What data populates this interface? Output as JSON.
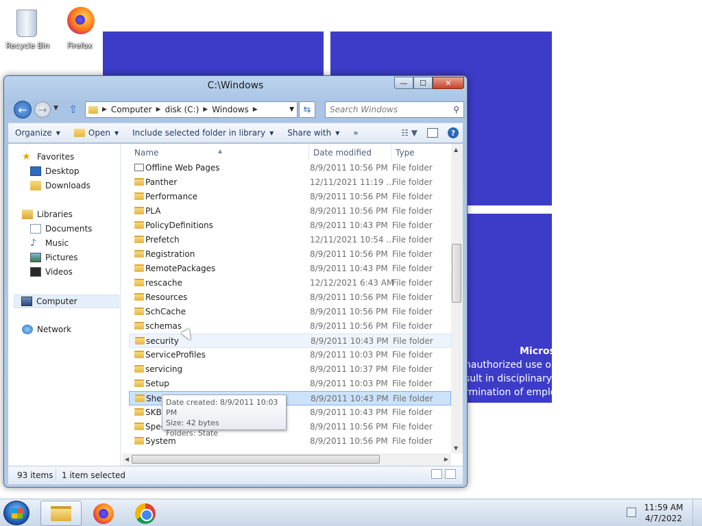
{
  "desktop": {
    "icons": [
      {
        "label": "Recycle Bin",
        "icon": "recycle-bin-icon"
      },
      {
        "label": "Firefox",
        "icon": "firefox-icon"
      }
    ],
    "notice": {
      "title": "Micros",
      "lines": [
        "nauthorized use or",
        "sult in disciplinary",
        "rmination of emplo"
      ]
    },
    "colors": {
      "wallpaper_tile": "#3c3cc8"
    }
  },
  "window": {
    "title": "C:\\Windows",
    "buttons": {
      "minimize": "—",
      "maximize": "☐",
      "close": "✕"
    },
    "address": {
      "crumbs": [
        "Computer",
        "disk (C:)",
        "Windows"
      ]
    },
    "search": {
      "placeholder": "Search Windows"
    },
    "toolbar": {
      "organize": "Organize",
      "open": "Open",
      "include": "Include selected folder in library",
      "share": "Share with",
      "more": "»"
    },
    "nav": {
      "favorites": "Favorites",
      "desktop": "Desktop",
      "downloads": "Downloads",
      "libraries": "Libraries",
      "documents": "Documents",
      "music": "Music",
      "pictures": "Pictures",
      "videos": "Videos",
      "computer": "Computer",
      "network": "Network"
    },
    "columns": {
      "name": "Name",
      "date": "Date modified",
      "type": "Type"
    },
    "files": [
      {
        "name": "Offline Web Pages",
        "date": "8/9/2011 10:56 PM",
        "type": "File folder"
      },
      {
        "name": "Panther",
        "date": "12/11/2021 11:19 ...",
        "type": "File folder"
      },
      {
        "name": "Performance",
        "date": "8/9/2011 10:56 PM",
        "type": "File folder"
      },
      {
        "name": "PLA",
        "date": "8/9/2011 10:56 PM",
        "type": "File folder"
      },
      {
        "name": "PolicyDefinitions",
        "date": "8/9/2011 10:43 PM",
        "type": "File folder"
      },
      {
        "name": "Prefetch",
        "date": "12/11/2021 10:54 ...",
        "type": "File folder"
      },
      {
        "name": "Registration",
        "date": "8/9/2011 10:56 PM",
        "type": "File folder"
      },
      {
        "name": "RemotePackages",
        "date": "8/9/2011 10:43 PM",
        "type": "File folder"
      },
      {
        "name": "rescache",
        "date": "12/12/2021 6:43 AM",
        "type": "File folder"
      },
      {
        "name": "Resources",
        "date": "8/9/2011 10:56 PM",
        "type": "File folder"
      },
      {
        "name": "SchCache",
        "date": "8/9/2011 10:56 PM",
        "type": "File folder"
      },
      {
        "name": "schemas",
        "date": "8/9/2011 10:56 PM",
        "type": "File folder"
      },
      {
        "name": "security",
        "date": "8/9/2011 10:43 PM",
        "type": "File folder"
      },
      {
        "name": "ServiceProfiles",
        "date": "8/9/2011 10:03 PM",
        "type": "File folder"
      },
      {
        "name": "servicing",
        "date": "8/9/2011 10:37 PM",
        "type": "File folder"
      },
      {
        "name": "Setup",
        "date": "8/9/2011 10:03 PM",
        "type": "File folder"
      },
      {
        "name": "ShellNew",
        "date": "8/9/2011 10:43 PM",
        "type": "File folder"
      },
      {
        "name": "SKB",
        "date": "8/9/2011 10:43 PM",
        "type": "File folder"
      },
      {
        "name": "Speech",
        "date": "8/9/2011 10:56 PM",
        "type": "File folder"
      },
      {
        "name": "System",
        "date": "8/9/2011 10:56 PM",
        "type": "File folder"
      }
    ],
    "tooltip": {
      "created": "Date created: 8/9/2011 10:03 PM",
      "size": "Size: 42 bytes",
      "folders": "Folders: State"
    },
    "status": {
      "count": "93 items",
      "selected": "1 item selected"
    }
  },
  "taskbar": {
    "apps": [
      "windows-explorer-icon",
      "firefox-icon",
      "chrome-icon"
    ],
    "clock": {
      "time": "11:59 AM",
      "date": "4/7/2022"
    }
  }
}
